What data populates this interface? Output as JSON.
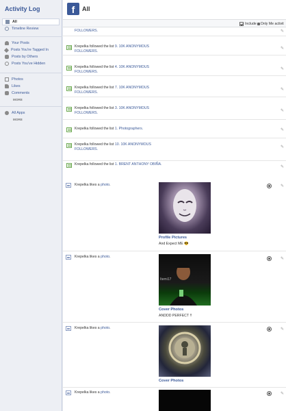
{
  "sidebar": {
    "title": "Activity Log",
    "items": [
      {
        "label": "All",
        "active": true,
        "icon": "list-icon"
      },
      {
        "label": "Timeline Review",
        "icon": "eye-icon"
      }
    ],
    "posts_items": [
      {
        "label": "Your Posts",
        "icon": "user-icon"
      },
      {
        "label": "Posts You're Tagged In",
        "icon": "tag-icon"
      },
      {
        "label": "Posts by Others",
        "icon": "people-icon"
      },
      {
        "label": "Posts You've Hidden",
        "icon": "hidden-icon"
      }
    ],
    "media_items": [
      {
        "label": "Photos",
        "icon": "photo-icon"
      },
      {
        "label": "Likes",
        "icon": "thumbs-up-icon"
      },
      {
        "label": "Comments",
        "icon": "comment-icon"
      }
    ],
    "media_more": "MORE",
    "apps_items": [
      {
        "label": "All Apps",
        "icon": "apps-icon"
      }
    ],
    "apps_more": "MORE"
  },
  "header": {
    "logo": "f",
    "title": "All"
  },
  "filter": {
    "prefix": "Include",
    "suffix": "Only Me activit",
    "checked": true
  },
  "feed": {
    "top_partial": "FOLLOWERS.",
    "list_rows": [
      {
        "actor": "Krepelka",
        "verb": "followed the list",
        "list_name": "9. 10K ANONYMOUS FOLLOWERS."
      },
      {
        "actor": "Krepelka",
        "verb": "followed the list",
        "list_name": "4. 10K ANONYMOUS FOLLOWERS."
      },
      {
        "actor": "Krepelka",
        "verb": "followed the list",
        "list_name": "7. 10K ANONYMOUS FOLLOWERS."
      },
      {
        "actor": "Krepelka",
        "verb": "followed the list",
        "list_name": "3. 10K ANONYMOUS FOLLOWERS."
      },
      {
        "actor": "Krepelka",
        "verb": "followed the list",
        "list_name": "1. Photographers."
      },
      {
        "actor": "Krepelka",
        "verb": "followed the list",
        "list_name": "10. 10K ANONYMOUS FOLLOWERS."
      },
      {
        "actor": "Krepelka",
        "verb": "followed the list",
        "list_name": "1. BRENT ANTHONY OBIÑA."
      }
    ],
    "like_rows": [
      {
        "actor": "Krepelka",
        "verb": "likes a",
        "object": "photo",
        "album": "Profile Pictures",
        "caption": "And Expect ME 😎"
      },
      {
        "actor": "Krepelka",
        "verb": "likes a",
        "object": "photo",
        "album": "Cover Photos",
        "caption": "ANDDD PERFECT !!"
      },
      {
        "actor": "Krepelka",
        "verb": "likes a",
        "object": "photo",
        "album": "Cover Photos",
        "caption": ""
      },
      {
        "actor": "Krepelka",
        "verb": "likes a",
        "object": "photo",
        "album": "",
        "caption": ""
      }
    ],
    "photo_watermark": "Itemi17"
  }
}
